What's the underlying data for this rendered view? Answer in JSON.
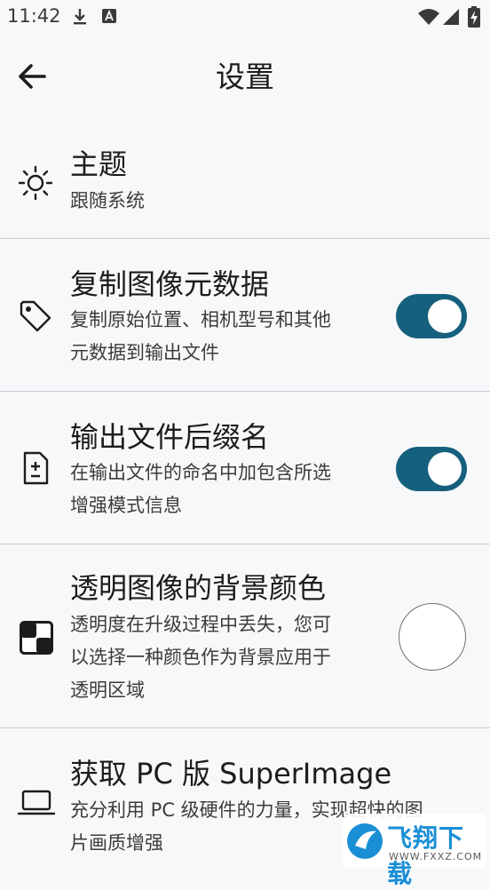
{
  "status_bar": {
    "time": "11:42",
    "left_icons": [
      "download-icon",
      "a-notification-icon"
    ],
    "right_icons": [
      "wifi-icon",
      "signal-icon",
      "battery-charging-icon"
    ]
  },
  "app_bar": {
    "back_icon": "arrow-back-icon",
    "title": "设置"
  },
  "settings": {
    "theme": {
      "icon": "sun-icon",
      "title": "主题",
      "subtitle": "跟随系统"
    },
    "copy_metadata": {
      "icon": "tag-icon",
      "title": "复制图像元数据",
      "subtitle_line1": "复制原始位置、相机型号和其他",
      "subtitle_line2": "元数据到输出文件",
      "enabled": true
    },
    "file_suffix": {
      "icon": "file-plus-minus-icon",
      "title": "输出文件后缀名",
      "subtitle_line1": "在输出文件的命名中加包含所选",
      "subtitle_line2": "增强模式信息",
      "enabled": true
    },
    "transparent_bg": {
      "icon": "checkerboard-icon",
      "title": "透明图像的背景颜色",
      "subtitle_line1": "透明度在升级过程中丢失，您可",
      "subtitle_line2": "以选择一种颜色作为背景应用于",
      "subtitle_line3": "透明区域",
      "color": "#ffffff"
    },
    "pc_version": {
      "icon": "laptop-icon",
      "title": "获取 PC 版 SuperImage",
      "subtitle_line1": "充分利用 PC 级硬件的力量，实现超快的图",
      "subtitle_line2": "片画质增强"
    }
  },
  "watermark": {
    "text": "飞翔下载",
    "url": "WWW.FXXZ.COM"
  },
  "colors": {
    "toggle_track": "#15607c",
    "background": "#f7f8fa",
    "divider": "#c9cacd"
  }
}
